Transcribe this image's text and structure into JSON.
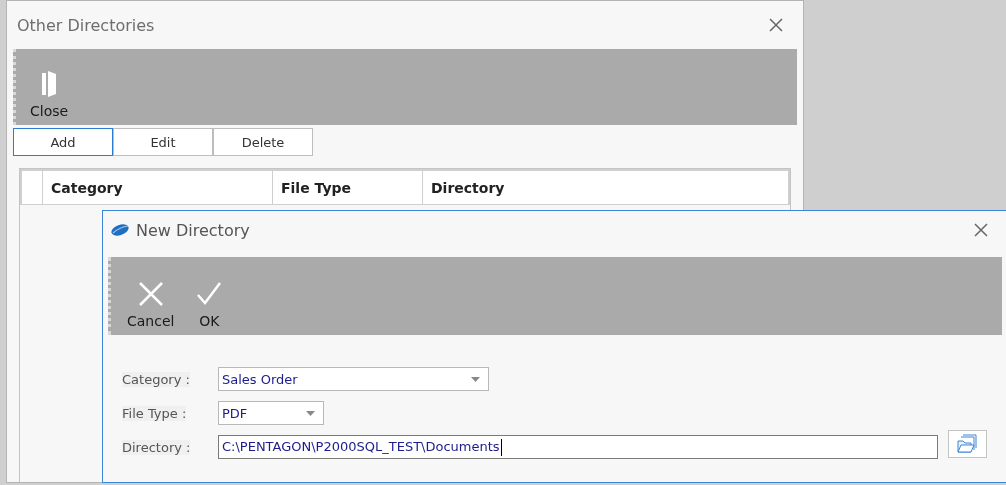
{
  "window": {
    "title": "Other Directories"
  },
  "toolbar": [
    {
      "label": "Close",
      "kind": "door"
    }
  ],
  "actions": [
    {
      "label": "Add",
      "selected": true
    },
    {
      "label": "Edit",
      "selected": false
    },
    {
      "label": "Delete",
      "selected": false
    }
  ],
  "table": {
    "columns": [
      "Category",
      "File Type",
      "Directory"
    ]
  },
  "dialog": {
    "title": "New Directory",
    "toolbar": [
      {
        "label": "Cancel",
        "kind": "cancel"
      },
      {
        "label": "OK",
        "kind": "ok"
      }
    ],
    "fields": [
      {
        "label": "Category :",
        "value": "Sales Order",
        "kind": "dropdown"
      },
      {
        "label": "File Type :",
        "value": "PDF",
        "kind": "dropdown"
      },
      {
        "label": "Directory :",
        "value": "C:\\PENTAGON\\P2000SQL_TEST\\Documents",
        "kind": "path"
      }
    ]
  }
}
